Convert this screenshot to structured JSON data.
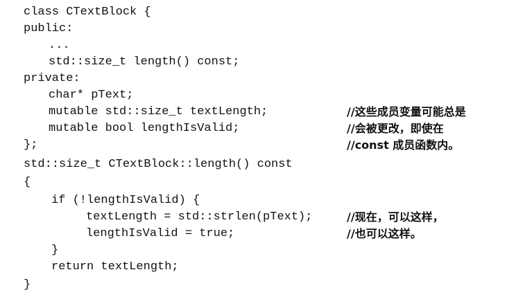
{
  "code_lines": [
    {
      "code": "class CTextBlock {",
      "comment": ""
    },
    {
      "code": "public:",
      "comment": ""
    },
    {
      "code": "...",
      "comment": ""
    },
    {
      "code": "std::size_t length() const;",
      "comment": ""
    },
    {
      "code": "private:",
      "comment": ""
    },
    {
      "code": "char* pText;",
      "comment": ""
    },
    {
      "code": "mutable std::size_t textLength;",
      "comment": "//这些成员变量可能总是"
    },
    {
      "code": "mutable bool lengthIsValid;",
      "comment": "//会被更改，即使在"
    },
    {
      "code": "};",
      "comment": "//const 成员函数内。"
    },
    {
      "code": "std::size_t CTextBlock::length() const",
      "comment": ""
    },
    {
      "code": "{",
      "comment": ""
    },
    {
      "code": "if (!lengthIsValid) {",
      "comment": ""
    },
    {
      "code": "textLength = std::strlen(pText);",
      "comment": "//现在，可以这样，"
    },
    {
      "code": "lengthIsValid = true;",
      "comment": "//也可以这样。"
    },
    {
      "code": "}",
      "comment": ""
    },
    {
      "code": "return textLength;",
      "comment": ""
    },
    {
      "code": "}",
      "comment": ""
    }
  ]
}
